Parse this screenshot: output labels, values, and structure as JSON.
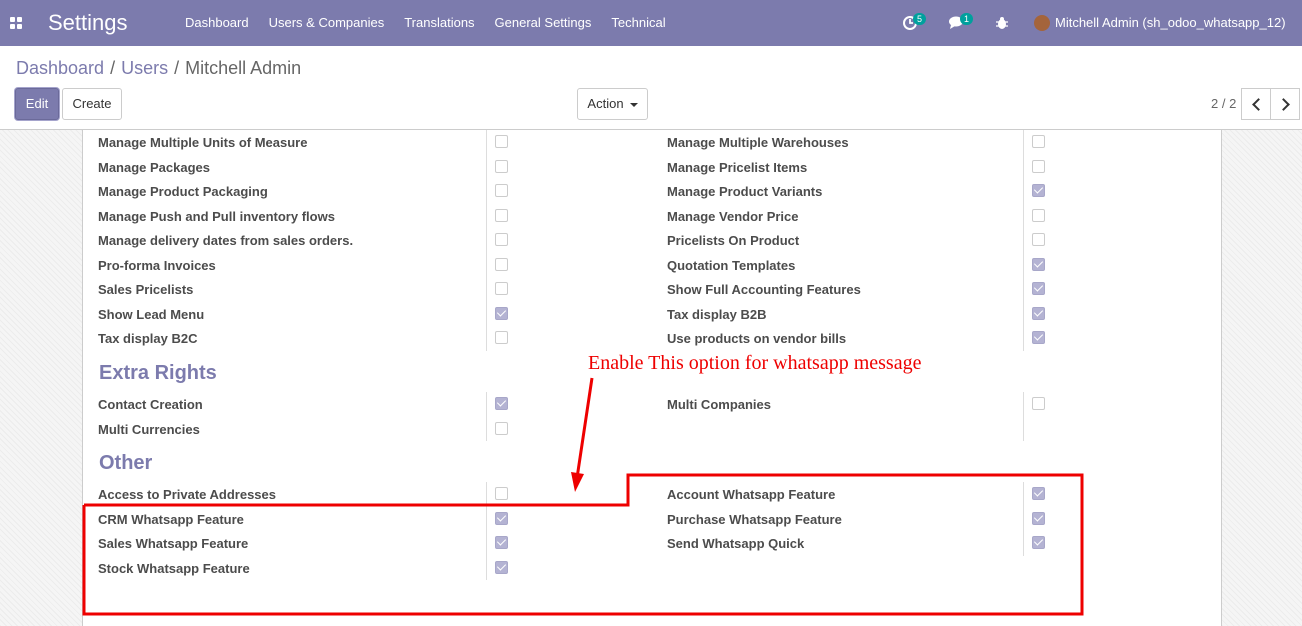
{
  "navbar": {
    "app_title": "Settings",
    "menu": [
      "Dashboard",
      "Users & Companies",
      "Translations",
      "General Settings",
      "Technical"
    ],
    "activity_count": "5",
    "messages_count": "1",
    "user": "Mitchell Admin (sh_odoo_whatsapp_12)"
  },
  "breadcrumb": {
    "dashboard": "Dashboard",
    "users": "Users",
    "current": "Mitchell Admin"
  },
  "buttons": {
    "edit": "Edit",
    "create": "Create",
    "action": "Action"
  },
  "pager": {
    "value": "2 / 2"
  },
  "permissions_left": [
    {
      "label": "Manage Multiple Units of Measure",
      "checked": false
    },
    {
      "label": "Manage Packages",
      "checked": false
    },
    {
      "label": "Manage Product Packaging",
      "checked": false
    },
    {
      "label": "Manage Push and Pull inventory flows",
      "checked": false
    },
    {
      "label": "Manage delivery dates from sales orders.",
      "checked": false
    },
    {
      "label": "Pro-forma Invoices",
      "checked": false
    },
    {
      "label": "Sales Pricelists",
      "checked": false
    },
    {
      "label": "Show Lead Menu",
      "checked": true
    },
    {
      "label": "Tax display B2C",
      "checked": false
    }
  ],
  "permissions_right": [
    {
      "label": "Manage Multiple Warehouses",
      "checked": false
    },
    {
      "label": "Manage Pricelist Items",
      "checked": false
    },
    {
      "label": "Manage Product Variants",
      "checked": true
    },
    {
      "label": "Manage Vendor Price",
      "checked": false
    },
    {
      "label": "Pricelists On Product",
      "checked": false
    },
    {
      "label": "Quotation Templates",
      "checked": true
    },
    {
      "label": "Show Full Accounting Features",
      "checked": true
    },
    {
      "label": "Tax display B2B",
      "checked": true
    },
    {
      "label": "Use products on vendor bills",
      "checked": true
    }
  ],
  "extra_rights": {
    "title": "Extra Rights",
    "left": [
      {
        "label": "Contact Creation",
        "checked": true
      },
      {
        "label": "Multi Currencies",
        "checked": false
      }
    ],
    "right": [
      {
        "label": "Multi Companies",
        "checked": false
      }
    ]
  },
  "other": {
    "title": "Other",
    "left": [
      {
        "label": "Access to Private Addresses",
        "checked": false
      },
      {
        "label": "CRM Whatsapp Feature",
        "checked": true
      },
      {
        "label": "Sales Whatsapp Feature",
        "checked": true
      },
      {
        "label": "Stock Whatsapp Feature",
        "checked": true
      }
    ],
    "right": [
      {
        "label": "Account Whatsapp Feature",
        "checked": true
      },
      {
        "label": "Purchase Whatsapp Feature",
        "checked": true
      },
      {
        "label": "Send Whatsapp Quick",
        "checked": true
      }
    ]
  },
  "annotation": {
    "text": "Enable This option for whatsapp message",
    "color": "#e00000"
  },
  "colors": {
    "navbar": "#7c7bad",
    "accent": "#7c7bad",
    "badge": "#00a09d"
  }
}
